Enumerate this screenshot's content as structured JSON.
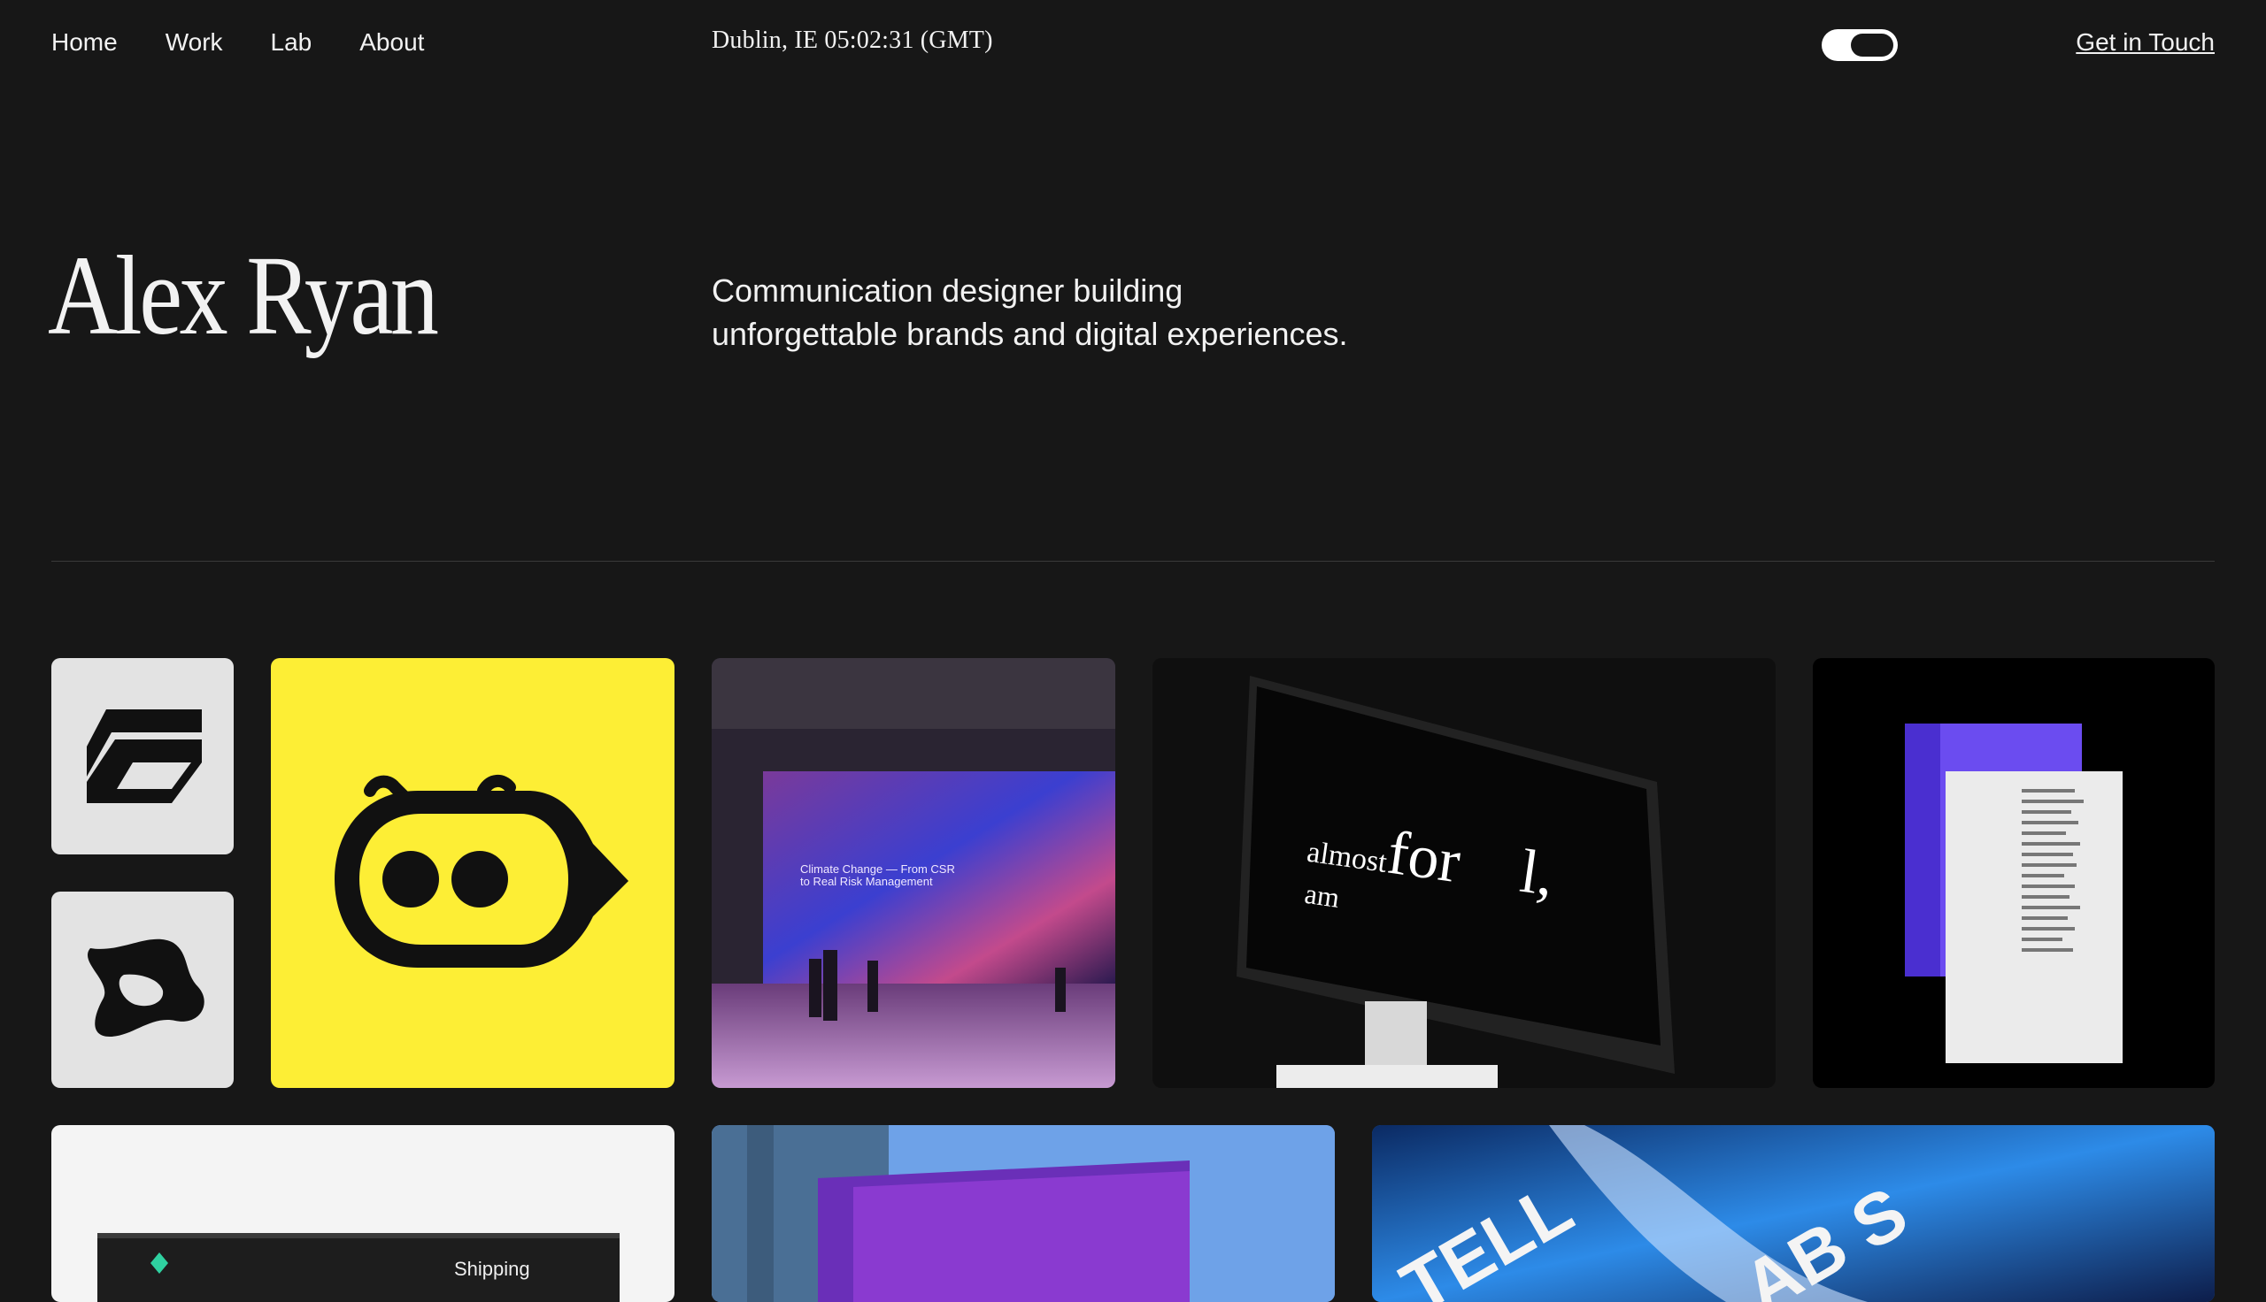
{
  "nav": {
    "links": [
      "Home",
      "Work",
      "Lab",
      "About"
    ],
    "clock": "Dublin, IE 05:02:31 (GMT)",
    "theme_toggle_icon": "toggle-switch-icon",
    "cta": "Get in Touch"
  },
  "hero": {
    "name": "Alex Ryan",
    "tagline_line1": "Communication designer building",
    "tagline_line2": "unforgettable brands and digital experiences."
  },
  "work": {
    "event_caption_1": "Climate Change — From CSR",
    "event_caption_2": "to Real Risk Management",
    "monitor_text_1": "almost",
    "monitor_text_2": "for",
    "monitor_text_3": "l,",
    "monitor_text_4": "am",
    "ship_label": "Shipping",
    "lab_text_1": "TELL",
    "lab_text_2": "AB S"
  },
  "colors": {
    "background": "#171717",
    "text": "#f2f2f2",
    "accent_yellow": "#fdee35",
    "tile_gray": "#e3e3e3",
    "poster_purple": "#6b4cf0"
  }
}
